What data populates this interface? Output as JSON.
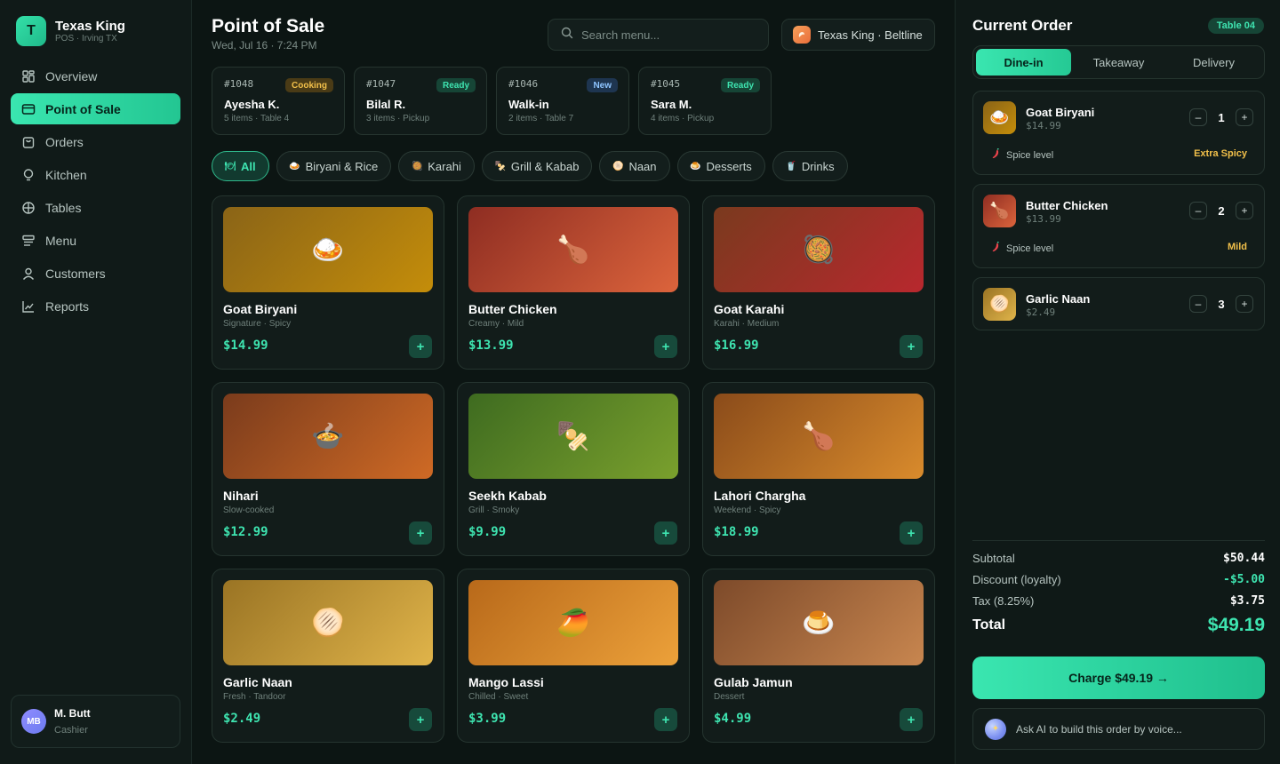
{
  "brand": {
    "initial": "T",
    "name": "Texas King",
    "subtitle": "POS · Irving TX"
  },
  "nav": [
    {
      "label": "Overview",
      "icon": "grid-icon"
    },
    {
      "label": "Point of Sale",
      "icon": "card-icon",
      "active": true
    },
    {
      "label": "Orders",
      "icon": "bag-icon"
    },
    {
      "label": "Kitchen",
      "icon": "bulb-icon"
    },
    {
      "label": "Tables",
      "icon": "table-icon"
    },
    {
      "label": "Menu",
      "icon": "menu-icon"
    },
    {
      "label": "Customers",
      "icon": "user-icon"
    },
    {
      "label": "Reports",
      "icon": "chart-icon"
    }
  ],
  "user": {
    "initials": "MB",
    "name": "M. Butt",
    "role": "Cashier"
  },
  "header": {
    "title": "Point of Sale",
    "date": "Wed, Jul 16 · 7:24 PM",
    "search_placeholder": "Search menu...",
    "store": "Texas King · Beltline"
  },
  "tickets": [
    {
      "id": "#1048",
      "status": "Cooking",
      "name": "Ayesha K.",
      "meta": "5 items · Table 4",
      "badge_bg": "#4a3b16",
      "badge_fg": "#f2c04a"
    },
    {
      "id": "#1047",
      "status": "Ready",
      "name": "Bilal R.",
      "meta": "3 items · Pickup",
      "badge_bg": "#164536",
      "badge_fg": "#3ee4b0"
    },
    {
      "id": "#1046",
      "status": "New",
      "name": "Walk-in",
      "meta": "2 items · Table 7",
      "badge_bg": "#1e3550",
      "badge_fg": "#8ec5ff"
    },
    {
      "id": "#1045",
      "status": "Ready",
      "name": "Sara M.",
      "meta": "4 items · Pickup",
      "badge_bg": "#164536",
      "badge_fg": "#3ee4b0"
    }
  ],
  "categories": [
    {
      "label": "All",
      "icon": "🍽",
      "active": true
    },
    {
      "label": "Biryani & Rice",
      "icon": "🍛"
    },
    {
      "label": "Karahi",
      "icon": "🥘"
    },
    {
      "label": "Grill & Kabab",
      "icon": "🍢"
    },
    {
      "label": "Naan",
      "icon": "🫓"
    },
    {
      "label": "Desserts",
      "icon": "🍮"
    },
    {
      "label": "Drinks",
      "icon": "🥤"
    }
  ],
  "menu_items": [
    {
      "name": "Goat Biryani",
      "desc": "Signature · Spicy",
      "price": "$14.99",
      "emoji": "🍛",
      "grad": [
        "#8a6417",
        "#c48d0a"
      ]
    },
    {
      "name": "Butter Chicken",
      "desc": "Creamy · Mild",
      "price": "$13.99",
      "emoji": "🍗",
      "grad": [
        "#8e2d22",
        "#dc643c"
      ]
    },
    {
      "name": "Goat Karahi",
      "desc": "Karahi · Medium",
      "price": "$16.99",
      "emoji": "🥘",
      "grad": [
        "#7a3a1e",
        "#b8282e"
      ]
    },
    {
      "name": "Nihari",
      "desc": "Slow-cooked",
      "price": "$12.99",
      "emoji": "🍲",
      "grad": [
        "#7a3b1c",
        "#cf6a25"
      ]
    },
    {
      "name": "Seekh Kabab",
      "desc": "Grill · Smoky",
      "price": "$9.99",
      "emoji": "🍢",
      "grad": [
        "#3e6b20",
        "#7aa02d"
      ]
    },
    {
      "name": "Lahori Chargha",
      "desc": "Weekend · Spicy",
      "price": "$18.99",
      "emoji": "🍗",
      "grad": [
        "#8a4b1a",
        "#d98b2c"
      ]
    },
    {
      "name": "Garlic Naan",
      "desc": "Fresh · Tandoor",
      "price": "$2.49",
      "emoji": "🫓",
      "grad": [
        "#9a7424",
        "#e0b44a"
      ]
    },
    {
      "name": "Mango Lassi",
      "desc": "Chilled · Sweet",
      "price": "$3.99",
      "emoji": "🥭",
      "grad": [
        "#b8691a",
        "#eca13a"
      ]
    },
    {
      "name": "Gulab Jamun",
      "desc": "Dessert",
      "price": "$4.99",
      "emoji": "🍮",
      "grad": [
        "#7d4a2a",
        "#c8864f"
      ]
    }
  ],
  "order": {
    "title": "Current Order",
    "table": "Table 04",
    "tabs": [
      {
        "label": "Dine-in",
        "active": true
      },
      {
        "label": "Takeaway"
      },
      {
        "label": "Delivery"
      }
    ],
    "items": [
      {
        "name": "Goat Biryani",
        "price": "$14.99",
        "qty": "1",
        "emoji": "🍛",
        "grad": [
          "#8a6417",
          "#c48d0a"
        ],
        "spice_label": "Spice level",
        "spice": "Extra Spicy",
        "spice_color": "#f2c04a"
      },
      {
        "name": "Butter Chicken",
        "price": "$13.99",
        "qty": "2",
        "emoji": "🍗",
        "grad": [
          "#8e2d22",
          "#dc643c"
        ],
        "spice_label": "Spice level",
        "spice": "Mild",
        "spice_color": "#f2c04a"
      },
      {
        "name": "Garlic Naan",
        "price": "$2.49",
        "qty": "3",
        "emoji": "🫓",
        "grad": [
          "#9a7424",
          "#e0b44a"
        ]
      }
    ],
    "subtotal_label": "Subtotal",
    "subtotal": "$50.44",
    "discount_label": "Discount (loyalty)",
    "discount": "-$5.00",
    "tax_label": "Tax (8.25%)",
    "tax": "$3.75",
    "total_label": "Total",
    "total": "$49.19",
    "charge_label": "Charge $49.19 →",
    "ai_prompt": "Ask AI to build this order by voice..."
  },
  "colors": {
    "accent": "#3ee4b0",
    "background": "#0c1513",
    "panel": "#121c1a"
  }
}
